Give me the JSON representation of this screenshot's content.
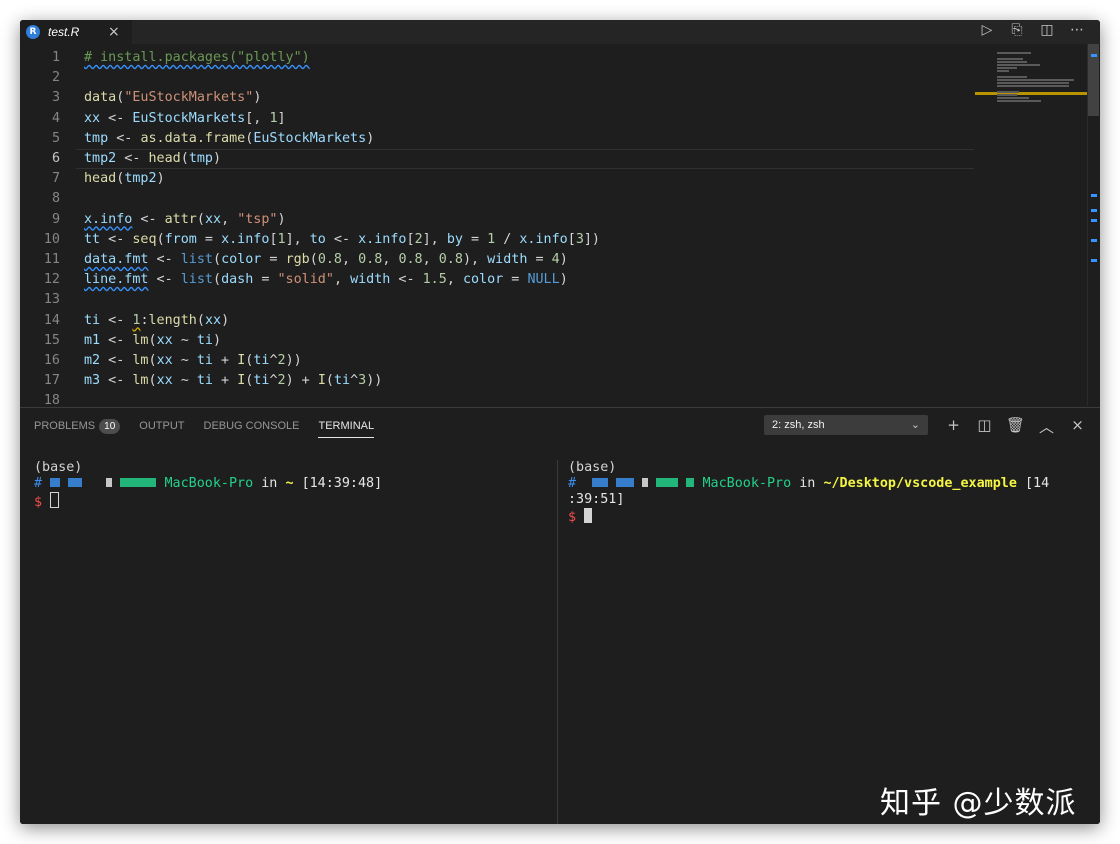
{
  "window": {
    "tab_title": "test.R",
    "tab_icon": "R",
    "tab_close": "×",
    "editor_actions": [
      "▷",
      "⎘",
      "◫",
      "⋯"
    ]
  },
  "editor": {
    "current_line": 6,
    "lines": [
      {
        "n": "1",
        "tokens": [
          {
            "t": "# install.packages(\"plotly\")",
            "c": "comment"
          }
        ]
      },
      {
        "n": "2",
        "tokens": []
      },
      {
        "n": "3",
        "tokens": [
          {
            "t": "data",
            "c": "fn"
          },
          {
            "t": "(",
            "c": "txt"
          },
          {
            "t": "\"EuStockMarkets\"",
            "c": "str"
          },
          {
            "t": ")",
            "c": "txt"
          }
        ]
      },
      {
        "n": "4",
        "tokens": [
          {
            "t": "xx",
            "c": "var"
          },
          {
            "t": " <- ",
            "c": "txt"
          },
          {
            "t": "EuStockMarkets",
            "c": "var"
          },
          {
            "t": "[, ",
            "c": "txt"
          },
          {
            "t": "1",
            "c": "num"
          },
          {
            "t": "]",
            "c": "txt"
          }
        ]
      },
      {
        "n": "5",
        "tokens": [
          {
            "t": "tmp",
            "c": "var"
          },
          {
            "t": " <- ",
            "c": "txt"
          },
          {
            "t": "as.data.frame",
            "c": "fn"
          },
          {
            "t": "(",
            "c": "txt"
          },
          {
            "t": "EuStockMarkets",
            "c": "var"
          },
          {
            "t": ")",
            "c": "txt"
          }
        ]
      },
      {
        "n": "6",
        "tokens": [
          {
            "t": "tmp2",
            "c": "var"
          },
          {
            "t": " <- ",
            "c": "txt"
          },
          {
            "t": "head",
            "c": "fn"
          },
          {
            "t": "(",
            "c": "txt"
          },
          {
            "t": "tmp",
            "c": "var"
          },
          {
            "t": ")",
            "c": "txt"
          }
        ]
      },
      {
        "n": "7",
        "tokens": [
          {
            "t": "head",
            "c": "fn"
          },
          {
            "t": "(",
            "c": "txt"
          },
          {
            "t": "tmp2",
            "c": "var"
          },
          {
            "t": ")",
            "c": "txt"
          }
        ]
      },
      {
        "n": "8",
        "tokens": []
      },
      {
        "n": "9",
        "tokens": [
          {
            "t": "x.info",
            "c": "var",
            "sq": 1
          },
          {
            "t": " <- ",
            "c": "txt"
          },
          {
            "t": "attr",
            "c": "fn"
          },
          {
            "t": "(",
            "c": "txt"
          },
          {
            "t": "xx",
            "c": "var"
          },
          {
            "t": ", ",
            "c": "txt"
          },
          {
            "t": "\"tsp\"",
            "c": "str"
          },
          {
            "t": ")",
            "c": "txt"
          }
        ]
      },
      {
        "n": "10",
        "tokens": [
          {
            "t": "tt",
            "c": "var"
          },
          {
            "t": " <- ",
            "c": "txt"
          },
          {
            "t": "seq",
            "c": "fn"
          },
          {
            "t": "(",
            "c": "txt"
          },
          {
            "t": "from",
            "c": "var"
          },
          {
            "t": " = ",
            "c": "txt"
          },
          {
            "t": "x.info",
            "c": "var"
          },
          {
            "t": "[",
            "c": "txt"
          },
          {
            "t": "1",
            "c": "num"
          },
          {
            "t": "], ",
            "c": "txt"
          },
          {
            "t": "to",
            "c": "var"
          },
          {
            "t": " <- ",
            "c": "txt"
          },
          {
            "t": "x.info",
            "c": "var"
          },
          {
            "t": "[",
            "c": "txt"
          },
          {
            "t": "2",
            "c": "num"
          },
          {
            "t": "], ",
            "c": "txt"
          },
          {
            "t": "by",
            "c": "var"
          },
          {
            "t": " = ",
            "c": "txt"
          },
          {
            "t": "1",
            "c": "num"
          },
          {
            "t": " / ",
            "c": "txt"
          },
          {
            "t": "x.info",
            "c": "var"
          },
          {
            "t": "[",
            "c": "txt"
          },
          {
            "t": "3",
            "c": "num"
          },
          {
            "t": "])",
            "c": "txt"
          }
        ]
      },
      {
        "n": "11",
        "tokens": [
          {
            "t": "data.fmt",
            "c": "var",
            "sq": 1
          },
          {
            "t": " <- ",
            "c": "txt"
          },
          {
            "t": "list",
            "c": "kw"
          },
          {
            "t": "(",
            "c": "txt"
          },
          {
            "t": "color",
            "c": "var"
          },
          {
            "t": " = ",
            "c": "txt"
          },
          {
            "t": "rgb",
            "c": "fn"
          },
          {
            "t": "(",
            "c": "txt"
          },
          {
            "t": "0.8",
            "c": "num"
          },
          {
            "t": ", ",
            "c": "txt"
          },
          {
            "t": "0.8",
            "c": "num"
          },
          {
            "t": ", ",
            "c": "txt"
          },
          {
            "t": "0.8",
            "c": "num"
          },
          {
            "t": ", ",
            "c": "txt"
          },
          {
            "t": "0.8",
            "c": "num"
          },
          {
            "t": "), ",
            "c": "txt"
          },
          {
            "t": "width",
            "c": "var"
          },
          {
            "t": " = ",
            "c": "txt"
          },
          {
            "t": "4",
            "c": "num"
          },
          {
            "t": ")",
            "c": "txt"
          }
        ]
      },
      {
        "n": "12",
        "tokens": [
          {
            "t": "line.fmt",
            "c": "var",
            "sq": 1
          },
          {
            "t": " <- ",
            "c": "txt"
          },
          {
            "t": "list",
            "c": "kw"
          },
          {
            "t": "(",
            "c": "txt"
          },
          {
            "t": "dash",
            "c": "var"
          },
          {
            "t": " = ",
            "c": "txt"
          },
          {
            "t": "\"solid\"",
            "c": "str"
          },
          {
            "t": ", ",
            "c": "txt"
          },
          {
            "t": "width",
            "c": "var"
          },
          {
            "t": " <- ",
            "c": "txt"
          },
          {
            "t": "1.5",
            "c": "num"
          },
          {
            "t": ", ",
            "c": "txt"
          },
          {
            "t": "color",
            "c": "var"
          },
          {
            "t": " = ",
            "c": "txt"
          },
          {
            "t": "NULL",
            "c": "kw"
          },
          {
            "t": ")",
            "c": "txt"
          }
        ]
      },
      {
        "n": "13",
        "tokens": []
      },
      {
        "n": "14",
        "tokens": [
          {
            "t": "ti",
            "c": "var"
          },
          {
            "t": " <- ",
            "c": "txt"
          },
          {
            "t": "1",
            "c": "num",
            "sqw": 1
          },
          {
            "t": ":",
            "c": "txt"
          },
          {
            "t": "length",
            "c": "fn"
          },
          {
            "t": "(",
            "c": "txt"
          },
          {
            "t": "xx",
            "c": "var"
          },
          {
            "t": ")",
            "c": "txt"
          }
        ]
      },
      {
        "n": "15",
        "tokens": [
          {
            "t": "m1",
            "c": "var"
          },
          {
            "t": " <- ",
            "c": "txt"
          },
          {
            "t": "lm",
            "c": "fn"
          },
          {
            "t": "(",
            "c": "txt"
          },
          {
            "t": "xx",
            "c": "var"
          },
          {
            "t": " ~ ",
            "c": "txt"
          },
          {
            "t": "ti",
            "c": "var"
          },
          {
            "t": ")",
            "c": "txt"
          }
        ]
      },
      {
        "n": "16",
        "tokens": [
          {
            "t": "m2",
            "c": "var"
          },
          {
            "t": " <- ",
            "c": "txt"
          },
          {
            "t": "lm",
            "c": "fn"
          },
          {
            "t": "(",
            "c": "txt"
          },
          {
            "t": "xx",
            "c": "var"
          },
          {
            "t": " ~ ",
            "c": "txt"
          },
          {
            "t": "ti",
            "c": "var"
          },
          {
            "t": " + ",
            "c": "txt"
          },
          {
            "t": "I",
            "c": "fn"
          },
          {
            "t": "(",
            "c": "txt"
          },
          {
            "t": "ti",
            "c": "var"
          },
          {
            "t": "^",
            "c": "txt"
          },
          {
            "t": "2",
            "c": "num"
          },
          {
            "t": "))",
            "c": "txt"
          }
        ]
      },
      {
        "n": "17",
        "tokens": [
          {
            "t": "m3",
            "c": "var"
          },
          {
            "t": " <- ",
            "c": "txt"
          },
          {
            "t": "lm",
            "c": "fn"
          },
          {
            "t": "(",
            "c": "txt"
          },
          {
            "t": "xx",
            "c": "var"
          },
          {
            "t": " ~ ",
            "c": "txt"
          },
          {
            "t": "ti",
            "c": "var"
          },
          {
            "t": " + ",
            "c": "txt"
          },
          {
            "t": "I",
            "c": "fn"
          },
          {
            "t": "(",
            "c": "txt"
          },
          {
            "t": "ti",
            "c": "var"
          },
          {
            "t": "^",
            "c": "txt"
          },
          {
            "t": "2",
            "c": "num"
          },
          {
            "t": ") + ",
            "c": "txt"
          },
          {
            "t": "I",
            "c": "fn"
          },
          {
            "t": "(",
            "c": "txt"
          },
          {
            "t": "ti",
            "c": "var"
          },
          {
            "t": "^",
            "c": "txt"
          },
          {
            "t": "3",
            "c": "num"
          },
          {
            "t": "))",
            "c": "txt"
          }
        ]
      },
      {
        "n": "18",
        "tokens": []
      }
    ]
  },
  "panel": {
    "tabs": [
      {
        "label": "PROBLEMS",
        "badge": "10"
      },
      {
        "label": "OUTPUT"
      },
      {
        "label": "DEBUG CONSOLE"
      },
      {
        "label": "TERMINAL",
        "active": true
      }
    ],
    "terminal_select": "2: zsh, zsh",
    "terminal_select_chevron": "⌄",
    "actions": [
      "+",
      "◫",
      "🗑",
      "︿",
      "×"
    ]
  },
  "terminal_left": {
    "env": "(base)",
    "hash": "#",
    "host": "MacBook-Pro",
    "in": "in",
    "path": "~",
    "time": "[14:39:48]",
    "prompt": "$"
  },
  "terminal_right": {
    "env": "(base)",
    "hash": "#",
    "host": "MacBook-Pro",
    "in": "in",
    "path": "~/Desktop/vscode_example",
    "time_a": "[14",
    "time_b": ":39:51]",
    "prompt": "$"
  },
  "watermark": "知乎 @少数派",
  "colors": {
    "editor_bg": "#1e1e1e",
    "comment": "#6a9955",
    "function": "#dcdcaa",
    "variable": "#9cdcfe",
    "string": "#ce9178",
    "number": "#b5cea8",
    "keyword": "#569cd6",
    "terminal_green": "#23d18b",
    "terminal_yellow": "#f5f543",
    "terminal_red": "#f14c4c"
  }
}
